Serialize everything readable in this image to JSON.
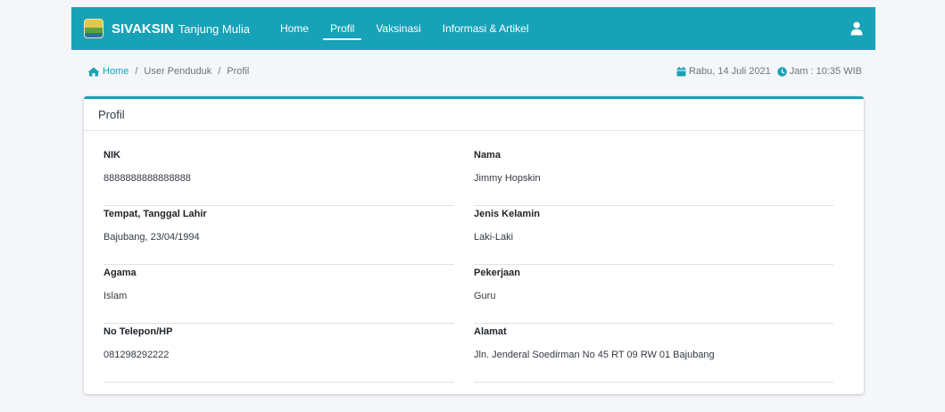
{
  "nav": {
    "brand_name": "SIVAKSIN",
    "brand_sub": "Tanjung Mulia",
    "items": [
      {
        "label": "Home",
        "active": false
      },
      {
        "label": "Profil",
        "active": true
      },
      {
        "label": "Vaksinasi",
        "active": false
      },
      {
        "label": "Informasi & Artikel",
        "active": false
      }
    ],
    "user_icon": "user-icon"
  },
  "breadcrumb": {
    "home": "Home",
    "user": "User Penduduk",
    "current": "Profil",
    "separator": "/"
  },
  "datetime": {
    "date": "Rabu, 14 Juli 2021",
    "time": "Jam : 10:35 WIB",
    "calendar_icon": "calendar-icon",
    "clock_icon": "clock-icon"
  },
  "card": {
    "title": "Profil",
    "fields": [
      {
        "label": "NIK",
        "value": "8888888888888888"
      },
      {
        "label": "Nama",
        "value": "Jimmy Hopskin"
      },
      {
        "label": "Tempat, Tanggal Lahir",
        "value": "Bajubang, 23/04/1994"
      },
      {
        "label": "Jenis Kelamin",
        "value": "Laki-Laki"
      },
      {
        "label": "Agama",
        "value": "Islam"
      },
      {
        "label": "Pekerjaan",
        "value": "Guru"
      },
      {
        "label": "No Telepon/HP",
        "value": "081298292222"
      },
      {
        "label": "Alamat",
        "value": "Jln. Jenderal Soedirman No 45 RT 09 RW 01 Bajubang"
      }
    ]
  },
  "colors": {
    "accent": "#17a2b8",
    "background": "#f4f6f9"
  }
}
